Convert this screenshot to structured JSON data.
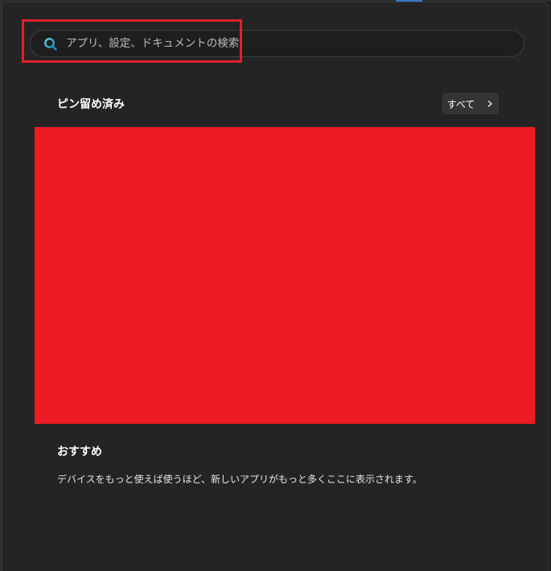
{
  "search": {
    "placeholder": "アプリ、設定、ドキュメントの検索",
    "icon": "search-icon"
  },
  "pinned": {
    "title": "ピン留め済み",
    "all_button_label": "すべて",
    "all_button_icon": "chevron-right-icon"
  },
  "recommended": {
    "title": "おすすめ",
    "message": "デバイスをもっと使えば使うほど、新しいアプリがもっと多くここに表示されます。"
  },
  "colors": {
    "panel_background": "#242424",
    "highlight": "#e0202a",
    "redacted_area": "#ed1c24",
    "search_icon_accent": "#3fb0d8"
  }
}
